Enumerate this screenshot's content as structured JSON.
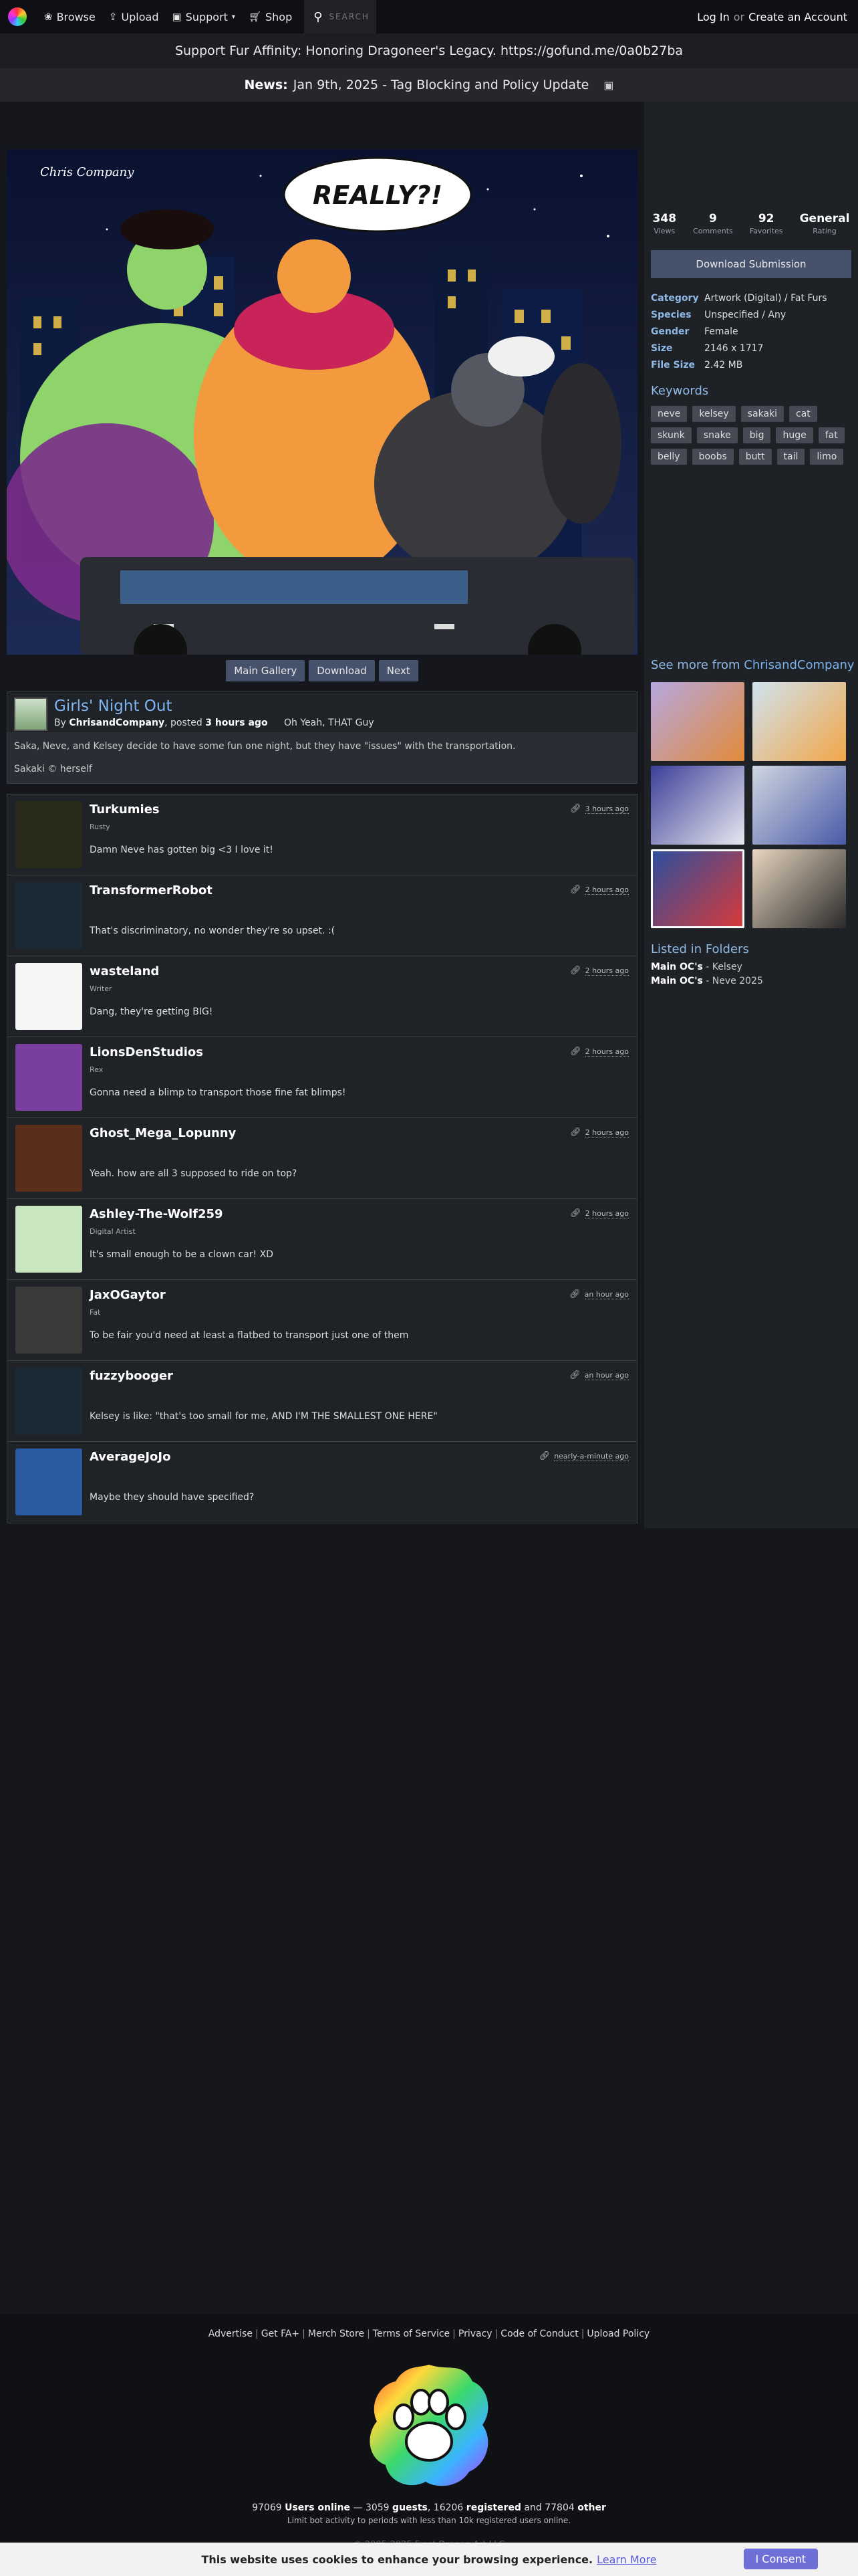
{
  "nav": {
    "browse": "Browse",
    "upload": "Upload",
    "support": "Support",
    "shop": "Shop",
    "search_placeholder": "SEARCH",
    "login": "Log In",
    "or": "or",
    "create_account": "Create an Account"
  },
  "banner": "Support Fur Affinity: Honoring Dragoneer's Legacy. https://gofund.me/0a0b27ba",
  "news": {
    "label": "News:",
    "text": "Jan 9th, 2025 - Tag Blocking and Policy Update"
  },
  "artwork": {
    "speech": "REALLY?!",
    "watermark": "Chris Company"
  },
  "art_buttons": [
    "Main Gallery",
    "Download",
    "Next"
  ],
  "submission": {
    "title": "Girls' Night Out",
    "by": "By",
    "artist": "ChrisandCompany",
    "posted": ", posted",
    "time": "3 hours ago",
    "tagline": "Oh Yeah, THAT Guy",
    "description": "Saka, Neve, and Kelsey decide to have some fun one night, but they have \"issues\" with the transportation.",
    "credit": "Sakaki © herself"
  },
  "comments": [
    {
      "name": "Turkumies",
      "role": "Rusty",
      "time": "3 hours ago",
      "text": "Damn Neve has gotten big <3 I love it!",
      "avatar_color": "#2a2a1a"
    },
    {
      "name": "TransformerRobot",
      "role": "",
      "time": "2 hours ago",
      "text": "That's discriminatory, no wonder they're so upset. :(",
      "avatar_color": "#1c2a38"
    },
    {
      "name": "wasteland",
      "role": "Writer",
      "time": "2 hours ago",
      "text": "Dang, they're getting BIG!",
      "avatar_color": "#f5f5f5"
    },
    {
      "name": "LionsDenStudios",
      "role": "Rex",
      "time": "2 hours ago",
      "text": "Gonna need a blimp to transport those fine fat blimps!",
      "avatar_color": "#7a3ea1"
    },
    {
      "name": "Ghost_Mega_Lopunny",
      "role": "",
      "time": "2 hours ago",
      "text": "Yeah. how are all 3 supposed to ride on top?",
      "avatar_color": "#5a2e1a"
    },
    {
      "name": "Ashley-The-Wolf259",
      "role": "Digital Artist",
      "time": "2 hours ago",
      "text": "It's small enough to be a clown car! XD",
      "avatar_color": "#c9e6c1"
    },
    {
      "name": "JaxOGaytor",
      "role": "Fat",
      "time": "an hour ago",
      "text": "To be fair you'd need at least a flatbed to transport just one of them",
      "avatar_color": "#3a3a3a"
    },
    {
      "name": "fuzzybooger",
      "role": "",
      "time": "an hour ago",
      "text": "Kelsey is like: \"that's too small for me, AND I'M THE SMALLEST ONE HERE\"",
      "avatar_color": "#1c2a38"
    },
    {
      "name": "AverageJoJo",
      "role": "",
      "time": "nearly-a-minute ago",
      "text": "Maybe they should have specified?",
      "avatar_color": "#2a5aa0"
    }
  ],
  "stats": [
    {
      "value": "348",
      "label": "Views"
    },
    {
      "value": "9",
      "label": "Comments"
    },
    {
      "value": "92",
      "label": "Favorites"
    },
    {
      "value": "General",
      "label": "Rating"
    }
  ],
  "download_submission": "Download Submission",
  "properties": [
    {
      "key": "Category",
      "value": "Artwork (Digital) / Fat Furs"
    },
    {
      "key": "Species",
      "value": "Unspecified / Any"
    },
    {
      "key": "Gender",
      "value": "Female"
    },
    {
      "key": "Size",
      "value": "2146 x 1717"
    },
    {
      "key": "File Size",
      "value": "2.42 MB"
    }
  ],
  "keywords_title": "Keywords",
  "keywords": [
    "neve",
    "kelsey",
    "sakaki",
    "cat",
    "skunk",
    "snake",
    "big",
    "huge",
    "fat",
    "belly",
    "boobs",
    "butt",
    "tail",
    "limo"
  ],
  "see_more": {
    "prefix": "See more from",
    "artist": "ChrisandCompany"
  },
  "folders": {
    "title": "Listed in Folders",
    "items": [
      {
        "folder": "Main OC's",
        "name": "Kelsey"
      },
      {
        "folder": "Main OC's",
        "name": "Neve 2025"
      }
    ]
  },
  "footer": {
    "links": [
      "Advertise",
      "Get FA+",
      "Merch Store",
      "Terms of Service",
      "Privacy",
      "Code of Conduct",
      "Upload Policy"
    ],
    "users_online": "97069",
    "users_online_label": "Users online",
    "guests": "3059",
    "guests_label": "guests",
    "registered": "16206",
    "registered_label": "registered",
    "and": "and",
    "other": "77804",
    "other_label": "other",
    "limit": "Limit bot activity to periods with less than 10k registered users online.",
    "copyright": "© 2005-2025 Frost Dragon Art LLC"
  },
  "cookie": {
    "text": "This website uses cookies to enhance your browsing experience.",
    "learn_more": "Learn More",
    "consent": "I Consent"
  }
}
